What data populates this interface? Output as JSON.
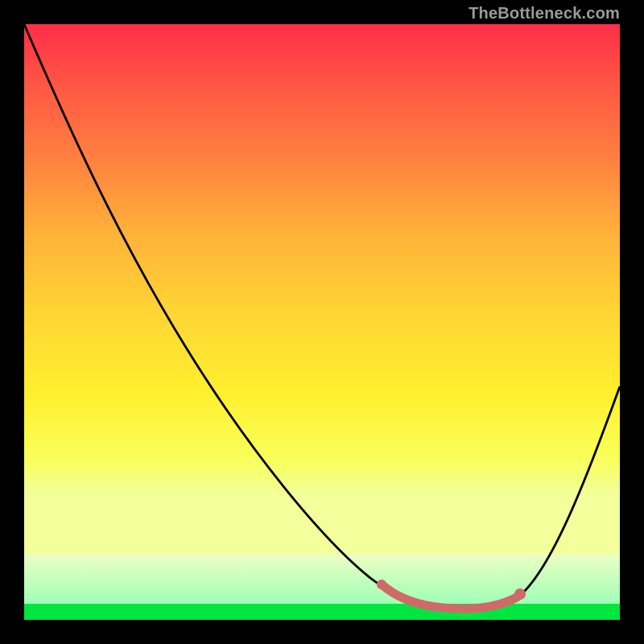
{
  "attribution": "TheBottleneck.com",
  "chart_data": {
    "type": "line",
    "title": "",
    "xlabel": "",
    "ylabel": "",
    "xlim": [
      0,
      100
    ],
    "ylim": [
      0,
      100
    ],
    "series": [
      {
        "name": "bottleneck-curve",
        "x": [
          0,
          8,
          16,
          24,
          32,
          40,
          48,
          56,
          62,
          66,
          70,
          74,
          78,
          82,
          86,
          90,
          94,
          98,
          100
        ],
        "values": [
          100,
          89,
          77,
          65,
          53,
          42,
          31,
          20,
          11,
          5,
          2,
          1,
          1,
          2,
          6,
          13,
          22,
          33,
          39
        ]
      },
      {
        "name": "optimal-band",
        "x": [
          62,
          66,
          70,
          74,
          78,
          82
        ],
        "values": [
          4,
          3,
          2,
          2,
          3,
          4
        ]
      }
    ],
    "highlight_color": "#d16a6a",
    "curve_color": "#000000",
    "background_gradient": [
      "#ff2e49",
      "#ffd634",
      "#f3ff9a",
      "#9fffb8",
      "#00e640"
    ]
  }
}
